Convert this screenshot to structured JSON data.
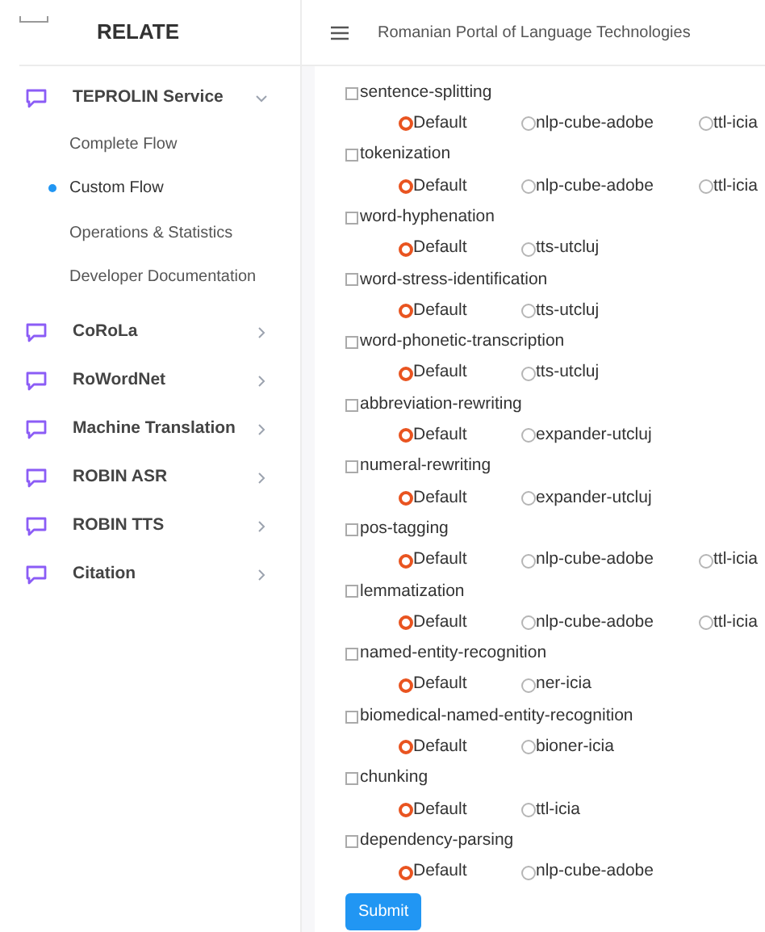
{
  "sidebar": {
    "brand": "RELATE",
    "items": [
      {
        "label": "TEPROLIN Service",
        "expanded": true,
        "children": [
          {
            "label": "Complete Flow",
            "selected": false
          },
          {
            "label": "Custom Flow",
            "selected": true
          },
          {
            "label": "Operations & Statistics",
            "selected": false
          },
          {
            "label": "Developer Documentation",
            "selected": false
          }
        ]
      },
      {
        "label": "CoRoLa",
        "expanded": false
      },
      {
        "label": "RoWordNet",
        "expanded": false
      },
      {
        "label": "Machine Translation",
        "expanded": false
      },
      {
        "label": "ROBIN ASR",
        "expanded": false
      },
      {
        "label": "ROBIN TTS",
        "expanded": false
      },
      {
        "label": "Citation",
        "expanded": false
      }
    ]
  },
  "header": {
    "title": "Romanian Portal of Language Technologies"
  },
  "tasks": [
    {
      "name": "sentence-splitting",
      "checked": false,
      "options": [
        {
          "label": "Default",
          "selected": true
        },
        {
          "label": "nlp-cube-adobe",
          "selected": false
        },
        {
          "label": "ttl-icia",
          "selected": false
        }
      ]
    },
    {
      "name": "tokenization",
      "checked": false,
      "options": [
        {
          "label": "Default",
          "selected": true
        },
        {
          "label": "nlp-cube-adobe",
          "selected": false
        },
        {
          "label": "ttl-icia",
          "selected": false
        }
      ]
    },
    {
      "name": "word-hyphenation",
      "checked": false,
      "options": [
        {
          "label": "Default",
          "selected": true
        },
        {
          "label": "tts-utcluj",
          "selected": false
        }
      ]
    },
    {
      "name": "word-stress-identification",
      "checked": false,
      "options": [
        {
          "label": "Default",
          "selected": true
        },
        {
          "label": "tts-utcluj",
          "selected": false
        }
      ]
    },
    {
      "name": "word-phonetic-transcription",
      "checked": false,
      "options": [
        {
          "label": "Default",
          "selected": true
        },
        {
          "label": "tts-utcluj",
          "selected": false
        }
      ]
    },
    {
      "name": "abbreviation-rewriting",
      "checked": false,
      "options": [
        {
          "label": "Default",
          "selected": true
        },
        {
          "label": "expander-utcluj",
          "selected": false
        }
      ]
    },
    {
      "name": "numeral-rewriting",
      "checked": false,
      "options": [
        {
          "label": "Default",
          "selected": true
        },
        {
          "label": "expander-utcluj",
          "selected": false
        }
      ]
    },
    {
      "name": "pos-tagging",
      "checked": false,
      "options": [
        {
          "label": "Default",
          "selected": true
        },
        {
          "label": "nlp-cube-adobe",
          "selected": false
        },
        {
          "label": "ttl-icia",
          "selected": false
        }
      ]
    },
    {
      "name": "lemmatization",
      "checked": false,
      "options": [
        {
          "label": "Default",
          "selected": true
        },
        {
          "label": "nlp-cube-adobe",
          "selected": false
        },
        {
          "label": "ttl-icia",
          "selected": false
        }
      ]
    },
    {
      "name": "named-entity-recognition",
      "checked": false,
      "options": [
        {
          "label": "Default",
          "selected": true
        },
        {
          "label": "ner-icia",
          "selected": false
        }
      ]
    },
    {
      "name": "biomedical-named-entity-recognition",
      "checked": false,
      "options": [
        {
          "label": "Default",
          "selected": true
        },
        {
          "label": "bioner-icia",
          "selected": false
        }
      ]
    },
    {
      "name": "chunking",
      "checked": false,
      "options": [
        {
          "label": "Default",
          "selected": true
        },
        {
          "label": "ttl-icia",
          "selected": false
        }
      ]
    },
    {
      "name": "dependency-parsing",
      "checked": false,
      "options": [
        {
          "label": "Default",
          "selected": true
        },
        {
          "label": "nlp-cube-adobe",
          "selected": false
        }
      ]
    }
  ],
  "submit": "Submit"
}
